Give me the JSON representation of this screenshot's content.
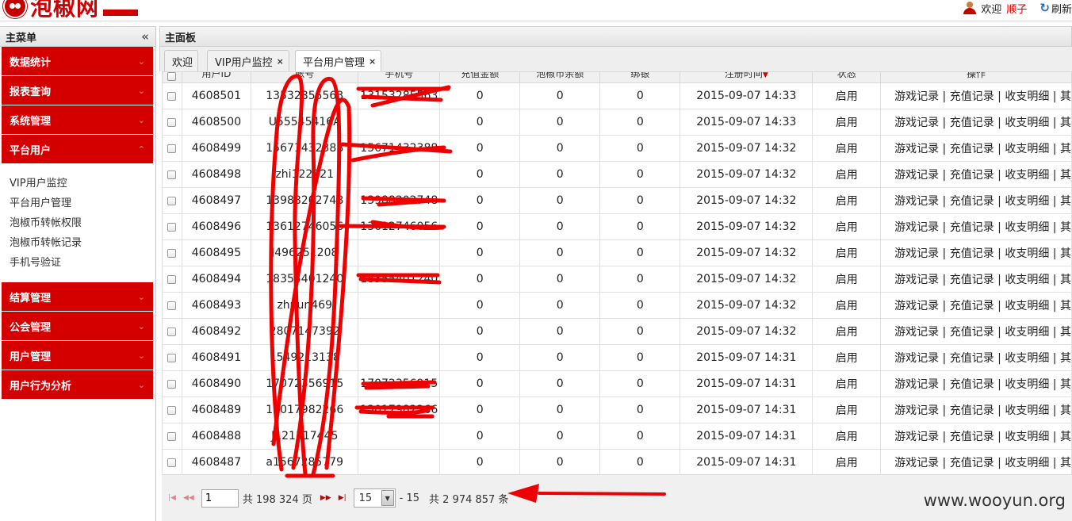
{
  "brand": {
    "logo_text": "泡椒网"
  },
  "header": {
    "welcome": "欢迎",
    "username": "顺子",
    "refresh": "刷新"
  },
  "sidebar": {
    "title": "主菜单",
    "groups_top": [
      {
        "label": "数据统计"
      },
      {
        "label": "报表查询"
      },
      {
        "label": "系统管理"
      },
      {
        "label": "平台用户"
      }
    ],
    "submenu": [
      {
        "label": "VIP用户监控"
      },
      {
        "label": "平台用户管理"
      },
      {
        "label": "泡椒币转帐权限"
      },
      {
        "label": "泡椒币转帐记录"
      },
      {
        "label": "手机号验证"
      }
    ],
    "groups_bottom": [
      {
        "label": "结算管理"
      },
      {
        "label": "公会管理"
      },
      {
        "label": "用户管理"
      },
      {
        "label": "用户行为分析"
      }
    ]
  },
  "main": {
    "title": "主面板",
    "tabs": [
      {
        "label": "欢迎"
      },
      {
        "label": "VIP用户监控"
      },
      {
        "label": "平台用户管理"
      }
    ]
  },
  "grid": {
    "columns": [
      "用户ID",
      "帐号",
      "手机号",
      "充值金额",
      "泡椒币余额",
      "绑银",
      "注册时间",
      "状态",
      "操作"
    ],
    "ops": "游戏记录 | 充值记录 | 收支明细 | 其",
    "rows": [
      {
        "id": "4608501",
        "account": "13532855563",
        "phone": "13153285563",
        "recharge": "0",
        "balance": "0",
        "bind": "0",
        "time": "2015-09-07 14:33",
        "status": "启用"
      },
      {
        "id": "4608500",
        "account": "U55545416A",
        "phone": "",
        "recharge": "0",
        "balance": "0",
        "bind": "0",
        "time": "2015-09-07 14:33",
        "status": "启用"
      },
      {
        "id": "4608499",
        "account": "15671432388",
        "phone": "15671432388",
        "recharge": "0",
        "balance": "0",
        "bind": "0",
        "time": "2015-09-07 14:32",
        "status": "启用"
      },
      {
        "id": "4608498",
        "account": "zhi122321",
        "phone": "",
        "recharge": "0",
        "balance": "0",
        "bind": "0",
        "time": "2015-09-07 14:32",
        "status": "启用"
      },
      {
        "id": "4608497",
        "account": "13988202748",
        "phone": "13988202748",
        "recharge": "0",
        "balance": "0",
        "bind": "0",
        "time": "2015-09-07 14:32",
        "status": "启用"
      },
      {
        "id": "4608496",
        "account": "13612746056",
        "phone": "13612746056",
        "recharge": "0",
        "balance": "0",
        "bind": "0",
        "time": "2015-09-07 14:32",
        "status": "启用"
      },
      {
        "id": "4608495",
        "account": "J496251208",
        "phone": "",
        "recharge": "0",
        "balance": "0",
        "bind": "0",
        "time": "2015-09-07 14:32",
        "status": "启用"
      },
      {
        "id": "4608494",
        "account": "18355401240",
        "phone": "18355401240",
        "recharge": "0",
        "balance": "0",
        "bind": "0",
        "time": "2015-09-07 14:32",
        "status": "启用"
      },
      {
        "id": "4608493",
        "account": "zhuun469",
        "phone": "",
        "recharge": "0",
        "balance": "0",
        "bind": "0",
        "time": "2015-09-07 14:32",
        "status": "启用"
      },
      {
        "id": "4608492",
        "account": "2807147392",
        "phone": "",
        "recharge": "0",
        "balance": "0",
        "bind": "0",
        "time": "2015-09-07 14:32",
        "status": "启用"
      },
      {
        "id": "4608491",
        "account": "1549213138",
        "phone": "",
        "recharge": "0",
        "balance": "0",
        "bind": "0",
        "time": "2015-09-07 14:31",
        "status": "启用"
      },
      {
        "id": "4608490",
        "account": "17072356915",
        "phone": "17072356915",
        "recharge": "0",
        "balance": "0",
        "bind": "0",
        "time": "2015-09-07 14:31",
        "status": "启用"
      },
      {
        "id": "4608489",
        "account": "13017982266",
        "phone": "13017982266",
        "recharge": "0",
        "balance": "0",
        "bind": "0",
        "time": "2015-09-07 14:31",
        "status": "启用"
      },
      {
        "id": "4608488",
        "account": "J121517445",
        "phone": "",
        "recharge": "0",
        "balance": "0",
        "bind": "0",
        "time": "2015-09-07 14:31",
        "status": "启用"
      },
      {
        "id": "4608487",
        "account": "a1567285779",
        "phone": "",
        "recharge": "0",
        "balance": "0",
        "bind": "0",
        "time": "2015-09-07 14:31",
        "status": "启用"
      }
    ]
  },
  "pager": {
    "page": "1",
    "total_pages": "共 198 324 页",
    "page_size": "15",
    "range": "- 15",
    "total": "共 2 974 857 条"
  },
  "watermark": "www.wooyun.org",
  "colors": {
    "menu_red": "#d40000",
    "status_green": "#1a9b1a",
    "annotation_red": "#ee0000"
  }
}
